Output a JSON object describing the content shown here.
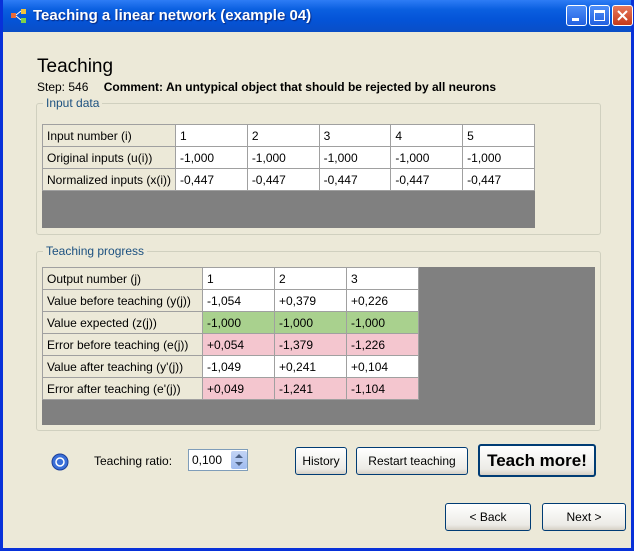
{
  "window": {
    "title": "Teaching a linear network (example 04)"
  },
  "header": {
    "heading": "Teaching",
    "step": "Step: 546",
    "comment": "Comment: An untypical object that should be rejected by all neurons"
  },
  "input_group": {
    "legend": "Input data",
    "rows": [
      {
        "label": "Input number (i)",
        "values": [
          "1",
          "2",
          "3",
          "4",
          "5"
        ]
      },
      {
        "label": "Original inputs (u(i))",
        "values": [
          "-1,000",
          "-1,000",
          "-1,000",
          "-1,000",
          "-1,000"
        ]
      },
      {
        "label": "Normalized inputs (x(i))",
        "values": [
          "-0,447",
          "-0,447",
          "-0,447",
          "-0,447",
          "-0,447"
        ]
      }
    ]
  },
  "progress_group": {
    "legend": "Teaching progress",
    "rows": [
      {
        "label": "Output number (j)",
        "values": [
          "1",
          "2",
          "3"
        ],
        "highlight": "none"
      },
      {
        "label": "Value before teaching (y(j))",
        "values": [
          "-1,054",
          "+0,379",
          "+0,226"
        ],
        "highlight": "none"
      },
      {
        "label": "Value expected (z(j))",
        "values": [
          "-1,000",
          "-1,000",
          "-1,000"
        ],
        "highlight": "green"
      },
      {
        "label": "Error before teaching (e(j))",
        "values": [
          "+0,054",
          "-1,379",
          "-1,226"
        ],
        "highlight": "pink"
      },
      {
        "label": "Value after teaching (y'(j))",
        "values": [
          "-1,049",
          "+0,241",
          "+0,104"
        ],
        "highlight": "none"
      },
      {
        "label": "Error after teaching (e'(j))",
        "values": [
          "+0,049",
          "-1,241",
          "-1,104"
        ],
        "highlight": "pink"
      }
    ]
  },
  "controls": {
    "ratio_label": "Teaching ratio:",
    "ratio_value": "0,100",
    "history_label": "History",
    "restart_label": "Restart teaching",
    "teach_label": "Teach more!"
  },
  "navigation": {
    "back_label": "< Back",
    "next_label": "Next >"
  },
  "colors": {
    "expected_row": "#a9d18e",
    "error_row": "#f4c6cf",
    "titlebar": "#0454d8"
  }
}
